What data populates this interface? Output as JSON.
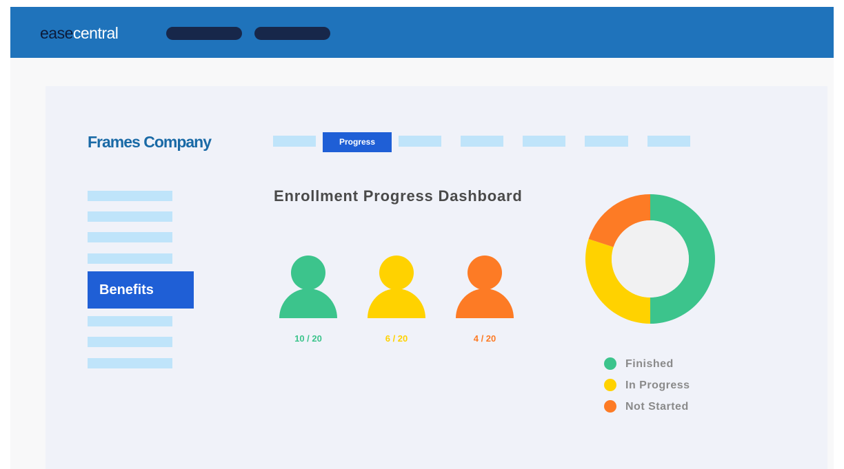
{
  "header": {
    "logo_part1": "ease",
    "logo_part2": "central"
  },
  "company": {
    "name": "Frames Company"
  },
  "top_nav": {
    "active_tab_label": "Progress"
  },
  "sidebar": {
    "active_item_label": "Benefits"
  },
  "dashboard": {
    "title": "Enrollment Progress Dashboard",
    "counts": [
      {
        "status": "Finished",
        "label": "10 / 20",
        "value": 10,
        "total": 20,
        "color": "#3cc48c"
      },
      {
        "status": "In Progress",
        "label": "6 / 20",
        "value": 6,
        "total": 20,
        "color": "#ffd200"
      },
      {
        "status": "Not Started",
        "label": "4 / 20",
        "value": 4,
        "total": 20,
        "color": "#fd7b25"
      }
    ]
  },
  "chart_data": {
    "type": "pie",
    "categories": [
      "Finished",
      "In Progress",
      "Not Started"
    ],
    "values": [
      10,
      6,
      4
    ],
    "colors": [
      "#3cc48c",
      "#ffd200",
      "#fd7b25"
    ],
    "donut": true,
    "legend_position": "bottom"
  },
  "legend": {
    "items": [
      {
        "label": "Finished",
        "color": "#3cc48c"
      },
      {
        "label": "In Progress",
        "color": "#ffd200"
      },
      {
        "label": "Not Started",
        "color": "#fd7b25"
      }
    ]
  },
  "colors": {
    "topbar": "#1f73bb",
    "accent": "#1f5fd6",
    "placeholder": "#bfe4fa",
    "panel": "#f0f2f9"
  }
}
